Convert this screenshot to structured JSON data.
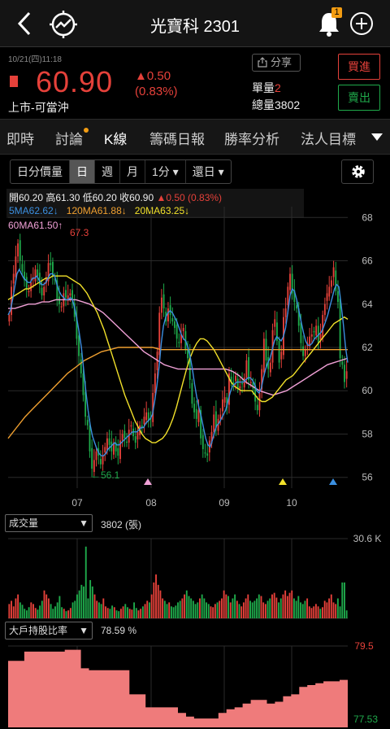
{
  "header": {
    "title": "光寶科 2301",
    "badge_count": "1"
  },
  "quote": {
    "datetime": "10/21(四)11:18",
    "price": "60.90",
    "change": "▲0.50",
    "change_pct": "(0.83%)",
    "market": "上市-可當沖",
    "share_label": "分享",
    "unit_volume": "單量2",
    "total_volume": "總量3802",
    "buy_label": "買進",
    "sell_label": "賣出"
  },
  "tabs": [
    "即時",
    "討論",
    "K線",
    "籌碼日報",
    "勝率分析",
    "法人目標"
  ],
  "controls": {
    "daily_price": "日分價量",
    "day": "日",
    "week": "週",
    "month": "月",
    "minute": "1分",
    "restore": "還日"
  },
  "ohlc": {
    "text": "開60.20 高61.30 低60.20 收60.90 ",
    "chg": "▲0.50 (0.83%)"
  },
  "ma": {
    "ma5": "5MA62.62↓",
    "ma120": "120MA61.88↓",
    "ma20": "20MA63.25↓",
    "ma60": "60MA61.50↑"
  },
  "annotations": {
    "high": "67.3",
    "low": "←56.1"
  },
  "price_axis": [
    "68",
    "66",
    "64",
    "62",
    "60",
    "58",
    "56"
  ],
  "months": [
    "07",
    "08",
    "09",
    "10"
  ],
  "volume": {
    "select": "成交量",
    "value": "3802 (張)",
    "max": "30.6 K"
  },
  "holder": {
    "select": "大戶持股比率",
    "value": "78.59 %",
    "max": "79.5",
    "min": "77.53"
  },
  "colors": {
    "up": "#e5413a",
    "down": "#1faa4b",
    "ma5": "#3b8fe0",
    "ma20": "#f2e12a",
    "ma60": "#f0a0d6",
    "ma120": "#f0a030",
    "holder_fill": "#ef7b7b"
  },
  "chart_data": {
    "type": "candlestick",
    "price_range": [
      55.5,
      68.5
    ],
    "close": [
      63.5,
      64.8,
      65.4,
      66.2,
      66.8,
      66.0,
      65.5,
      65.1,
      64.7,
      64.6,
      65.0,
      65.2,
      65.6,
      65.3,
      64.9,
      64.4,
      64.8,
      65.2,
      65.9,
      65.8,
      65.3,
      65.1,
      64.2,
      64.0,
      63.9,
      64.5,
      64.3,
      64.4,
      64.5,
      64.2,
      63.4,
      62.4,
      61.6,
      60.8,
      59.8,
      58.8,
      58.4,
      57.2,
      56.4,
      56.8,
      57.2,
      57.0,
      56.6,
      57.0,
      57.4,
      57.8,
      57.5,
      57.2,
      57.6,
      57.2,
      57.0,
      57.7,
      58.0,
      57.8,
      57.6,
      58.2,
      58.4,
      57.9,
      57.6,
      58.1,
      58.4,
      58.3,
      58.8,
      59.0,
      58.6,
      58.7,
      59.9,
      60.8,
      61.8,
      63.6,
      64.3,
      63.8,
      63.2,
      63.8,
      63.5,
      63.2,
      62.9,
      62.4,
      62.2,
      62.6,
      62.9,
      61.9,
      61.5,
      60.5,
      59.4,
      59.0,
      58.7,
      59.1,
      57.8,
      57.3,
      57.1,
      57.0,
      57.7,
      58.1,
      58.9,
      58.3,
      58.7,
      58.9,
      59.6,
      59.7,
      59.2,
      60.8,
      60.4,
      60.3,
      60.7,
      60.1,
      60.2,
      60.3,
      60.6,
      61.4,
      60.5,
      60.4,
      60.1,
      59.5,
      59.1,
      59.9,
      61.0,
      62.4,
      61.4,
      61.0,
      61.3,
      62.8,
      63.3,
      62.3,
      61.3,
      61.8,
      63.4,
      63.8,
      64.8,
      65.4,
      64.5,
      64.1,
      63.8,
      63.0,
      62.2,
      61.6,
      61.9,
      62.2,
      62.5,
      62.6,
      62.7,
      63.0,
      62.2,
      62.6,
      63.5,
      64.0,
      64.5,
      64.8,
      65.1,
      65.7,
      64.6,
      64.1,
      61.5,
      61.2,
      60.4,
      60.9
    ],
    "ma5": [
      63.5,
      63.7,
      64.2,
      64.8,
      65.4,
      65.6,
      65.4,
      65.2,
      65.1,
      65.0,
      65.0,
      65.2,
      65.2,
      65.3,
      65.1,
      64.9,
      64.9,
      65.0,
      65.2,
      65.4,
      65.4,
      65.3,
      64.9,
      64.6,
      64.4,
      64.3,
      64.2,
      64.2,
      64.3,
      64.2,
      63.8,
      63.3,
      62.7,
      62.0,
      61.0,
      60.0,
      59.1,
      58.4,
      57.9,
      57.6,
      57.3,
      57.1,
      57.0,
      57.0,
      57.1,
      57.3,
      57.4,
      57.5,
      57.6,
      57.5,
      57.5,
      57.6,
      57.7,
      57.8,
      57.9,
      58.0,
      58.1,
      58.1,
      58.1,
      58.2,
      58.3,
      58.3,
      58.5,
      58.6,
      58.7,
      58.9,
      59.5,
      60.2,
      61.1,
      62.2,
      63.0,
      63.4,
      63.6,
      63.7,
      63.6,
      63.4,
      63.2,
      62.9,
      62.6,
      62.4,
      62.3,
      62.0,
      61.6,
      61.0,
      60.3,
      59.7,
      59.2,
      58.8,
      58.3,
      57.8,
      57.5,
      57.4,
      57.7,
      58.1,
      58.4,
      58.5,
      58.7,
      58.9,
      59.1,
      59.5,
      59.9,
      60.2,
      60.3,
      60.4,
      60.4,
      60.4,
      60.4,
      60.5,
      60.6,
      60.6,
      60.5,
      60.3,
      60.0,
      59.9,
      60.1,
      60.6,
      61.0,
      61.3,
      61.5,
      61.9,
      62.3,
      62.5,
      62.4,
      62.3,
      62.5,
      62.9,
      63.6,
      64.4,
      64.7,
      64.6,
      64.2,
      63.7,
      63.2,
      62.7,
      62.3,
      62.1,
      62.1,
      62.2,
      62.4,
      62.5,
      62.6,
      62.7,
      62.9,
      63.2,
      63.5,
      63.9,
      64.3,
      64.7,
      64.9,
      64.8,
      64.0,
      63.1,
      62.0,
      61.3
    ],
    "ma20": [
      64.2,
      64.3,
      64.4,
      64.5,
      64.6,
      64.7,
      64.7,
      64.8,
      64.9,
      65.0,
      65.1,
      65.2,
      65.2,
      65.3,
      65.3,
      65.3,
      65.3,
      65.3,
      65.2,
      65.1,
      65.0,
      64.9,
      64.7,
      64.5,
      64.2,
      63.9,
      63.6,
      63.2,
      62.8,
      62.3,
      61.8,
      61.3,
      60.8,
      60.3,
      59.8,
      59.4,
      59.0,
      58.6,
      58.3,
      58.0,
      57.8,
      57.7,
      57.6,
      57.6,
      57.7,
      57.8,
      58.0,
      58.3,
      58.7,
      59.2,
      59.8,
      60.4,
      61.0,
      61.5,
      61.9,
      62.2,
      62.4,
      62.4,
      62.3,
      62.1,
      61.9,
      61.6,
      61.3,
      61.0,
      60.7,
      60.4,
      60.2,
      60.1,
      60.0,
      60.0,
      60.0,
      60.0,
      59.8,
      59.6,
      59.5,
      59.5,
      59.6,
      59.7,
      59.9,
      60.1,
      60.3,
      60.5,
      60.6,
      60.7,
      60.9,
      61.1,
      61.3,
      61.5,
      61.7,
      61.9,
      62.1,
      62.3,
      62.5,
      62.7,
      62.9,
      63.1,
      63.2,
      63.3,
      63.4,
      63.3
    ],
    "ma60": [
      63.8,
      63.8,
      63.9,
      64.0,
      64.0,
      64.1,
      64.1,
      64.2,
      64.2,
      64.2,
      64.2,
      64.1,
      64.0,
      63.8,
      63.6,
      63.3,
      63.0,
      62.7,
      62.4,
      62.1,
      61.8,
      61.6,
      61.4,
      61.2,
      61.1,
      61.0,
      61.0,
      61.0,
      61.0,
      61.0,
      61.0,
      61.0,
      61.0,
      60.9,
      60.7,
      60.4,
      60.2,
      60.0,
      59.9,
      59.8,
      59.9,
      60.0,
      60.2,
      60.4,
      60.6,
      60.8,
      61.0,
      61.2,
      61.3,
      61.4,
      61.5
    ],
    "ma120": [
      57.8,
      58.3,
      58.8,
      59.2,
      59.6,
      60.0,
      60.4,
      60.8,
      61.1,
      61.4,
      61.6,
      61.8,
      61.9,
      62.0,
      62.0,
      62.0,
      62.0,
      62.0,
      61.9,
      61.9,
      61.9,
      61.9,
      61.9,
      61.9,
      61.9,
      61.9,
      61.9,
      61.9,
      61.9,
      61.9,
      61.9,
      61.9,
      61.9,
      61.9,
      61.9,
      61.9,
      61.9,
      61.9,
      61.9,
      61.9,
      61.9
    ],
    "volume_max_k": 30.6,
    "volume_rel": [
      0.18,
      0.22,
      0.15,
      0.25,
      0.3,
      0.2,
      0.17,
      0.12,
      0.1,
      0.14,
      0.2,
      0.18,
      0.13,
      0.11,
      0.16,
      0.22,
      0.35,
      0.3,
      0.25,
      0.18,
      0.12,
      0.15,
      0.2,
      0.28,
      0.14,
      0.12,
      0.09,
      0.1,
      0.13,
      0.2,
      0.22,
      0.3,
      0.35,
      0.42,
      0.4,
      0.9,
      0.25,
      0.48,
      0.4,
      0.3,
      0.22,
      0.2,
      0.18,
      0.25,
      0.15,
      0.13,
      0.12,
      0.16,
      0.14,
      0.1,
      0.09,
      0.12,
      0.15,
      0.18,
      0.14,
      0.12,
      0.11,
      0.2,
      0.13,
      0.1,
      0.12,
      0.15,
      0.18,
      0.22,
      0.2,
      0.3,
      0.45,
      0.55,
      0.42,
      0.35,
      0.25,
      0.22,
      0.18,
      0.2,
      0.15,
      0.14,
      0.16,
      0.2,
      0.22,
      0.25,
      0.3,
      0.35,
      0.28,
      0.25,
      0.22,
      0.18,
      0.2,
      0.25,
      0.3,
      0.25,
      0.2,
      0.18,
      0.15,
      0.14,
      0.18,
      0.2,
      0.22,
      0.25,
      0.35,
      0.3,
      0.28,
      0.2,
      0.25,
      0.3,
      0.22,
      0.18,
      0.15,
      0.2,
      0.25,
      0.3,
      0.22,
      0.2,
      0.22,
      0.25,
      0.3,
      0.28,
      0.2,
      0.18,
      0.22,
      0.25,
      0.3,
      0.32,
      0.26,
      0.2,
      0.25,
      0.3,
      0.35,
      0.28,
      0.32,
      0.35,
      0.25,
      0.22,
      0.28,
      0.2,
      0.18,
      0.22,
      0.25,
      0.15,
      0.13,
      0.15,
      0.18,
      0.15,
      0.12,
      0.14,
      0.22,
      0.2,
      0.25,
      0.3,
      0.2,
      0.18,
      0.25,
      0.15,
      0.45,
      0.45,
      0.1
    ],
    "holder_ratio": [
      79.1,
      79.1,
      79.35,
      79.35,
      79.35,
      79.35,
      79.35,
      79.4,
      79.4,
      78.9,
      78.85,
      78.85,
      78.85,
      78.85,
      78.85,
      78.2,
      78.2,
      77.85,
      77.85,
      77.85,
      77.85,
      77.7,
      77.6,
      77.55,
      77.55,
      77.55,
      77.7,
      77.8,
      77.85,
      77.95,
      78.05,
      78.05,
      77.95,
      78.0,
      78.15,
      78.2,
      78.4,
      78.45,
      78.5,
      78.55,
      78.55,
      78.59
    ]
  }
}
